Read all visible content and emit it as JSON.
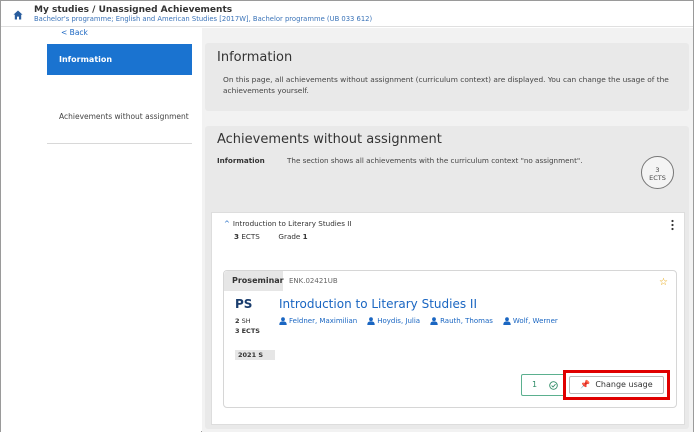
{
  "header": {
    "title": "My studies / Unassigned Achievements",
    "subtitle": "Bachelor's programme; English and American Studies [2017W], Bachelor programme (UB 033 612)"
  },
  "sidebar": {
    "back_label": "< Back",
    "items": [
      {
        "label": "Information",
        "active": true
      },
      {
        "label": "Achievements without assignment",
        "active": false
      }
    ]
  },
  "info_section": {
    "heading": "Information",
    "text": "On this page, all achievements without assignment (curriculum context) are displayed. You can change the usage of the achievements yourself."
  },
  "achievements_section": {
    "heading": "Achievements without assignment",
    "info_label": "Information",
    "info_text": "The section shows all achievements with the curriculum context \"no assignment\".",
    "ects_value": "3",
    "ects_unit": "ECTS"
  },
  "course_group": {
    "title": "Introduction to Literary Studies II",
    "ects_value": "3",
    "ects_unit": "ECTS",
    "grade_label": "Grade",
    "grade_value": "1"
  },
  "course": {
    "type_label": "Proseminar",
    "code": "ENK.02421UB",
    "abbr": "PS",
    "title": "Introduction to Literary Studies II",
    "sh_value": "2",
    "sh_unit": "SH",
    "ects_value": "3",
    "ects_unit": "ECTS",
    "semester": "2021 S",
    "lecturers": [
      "Feldner, Maximilian",
      "Hoydis, Julia",
      "Rauth, Thomas",
      "Wolf, Werner"
    ],
    "count": "1",
    "change_usage_label": "Change usage"
  },
  "colors": {
    "primary": "#1a73d0",
    "link": "#1a66c2",
    "highlight": "#e00000",
    "success": "#2e8b66",
    "star": "#e5a100"
  }
}
